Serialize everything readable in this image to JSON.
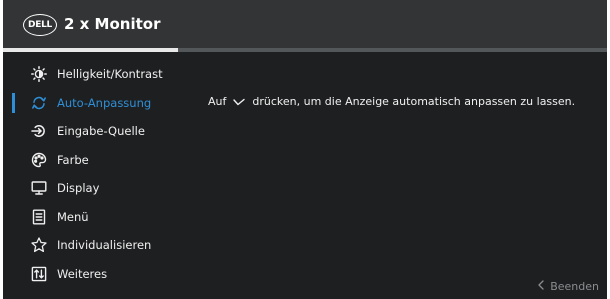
{
  "header": {
    "logo": "DELL",
    "title": "2 x Monitor",
    "progress_fraction": 0.29
  },
  "menu": {
    "items": [
      {
        "label": "Helligkeit/Kontrast",
        "icon": "brightness-icon"
      },
      {
        "label": "Auto-Anpassung",
        "icon": "auto-adjust-icon",
        "selected": true
      },
      {
        "label": "Eingabe-Quelle",
        "icon": "input-source-icon"
      },
      {
        "label": "Farbe",
        "icon": "palette-icon"
      },
      {
        "label": "Display",
        "icon": "display-icon"
      },
      {
        "label": "Menü",
        "icon": "menu-icon"
      },
      {
        "label": "Individualisieren",
        "icon": "star-icon"
      },
      {
        "label": "Weiteres",
        "icon": "others-icon"
      }
    ]
  },
  "content": {
    "message_before": "Auf",
    "message_icon": "check-icon",
    "message_after": "drücken, um die Anzeige automatisch anpassen zu lassen."
  },
  "footer": {
    "exit_label": "Beenden",
    "exit_icon": "chevron-left-icon"
  },
  "colors": {
    "background": "#1e1f21",
    "header": "#333436",
    "accent": "#2f8fd6",
    "muted": "#8a8d90"
  }
}
